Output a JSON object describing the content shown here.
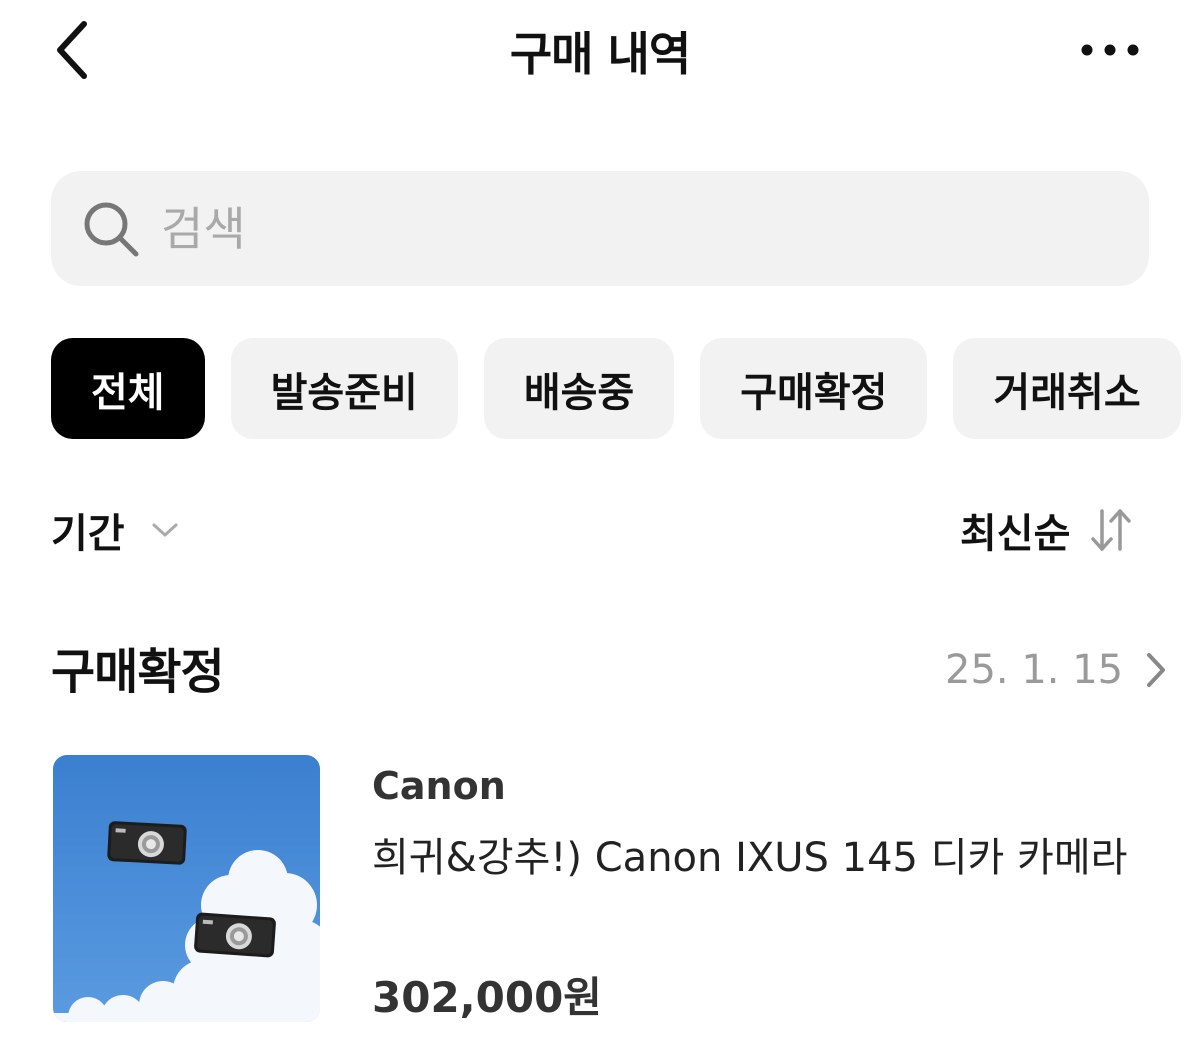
{
  "header": {
    "title": "구매 내역",
    "back_icon": "chevron-left-icon",
    "more_icon": "more-horizontal-icon"
  },
  "search": {
    "placeholder": "검색",
    "value": "",
    "icon": "search-icon"
  },
  "filters": {
    "chips": [
      {
        "label": "전체",
        "active": true
      },
      {
        "label": "발송준비",
        "active": false
      },
      {
        "label": "배송중",
        "active": false
      },
      {
        "label": "구매확정",
        "active": false
      },
      {
        "label": "거래취소",
        "active": false
      }
    ]
  },
  "controls": {
    "period_label": "기간",
    "period_icon": "chevron-down-icon",
    "sort_label": "최신순",
    "sort_icon": "sort-arrows-icon"
  },
  "orders": [
    {
      "status": "구매확정",
      "date": "25. 1. 15",
      "brand": "Canon",
      "name": "희귀&강추!) Canon IXUS 145 디카 카메라",
      "price": "302,000원"
    }
  ],
  "colors": {
    "active_chip_bg": "#000000",
    "chip_bg": "#f2f2f2",
    "search_bg": "#f2f2f2",
    "muted_text": "#9a9a9a"
  }
}
